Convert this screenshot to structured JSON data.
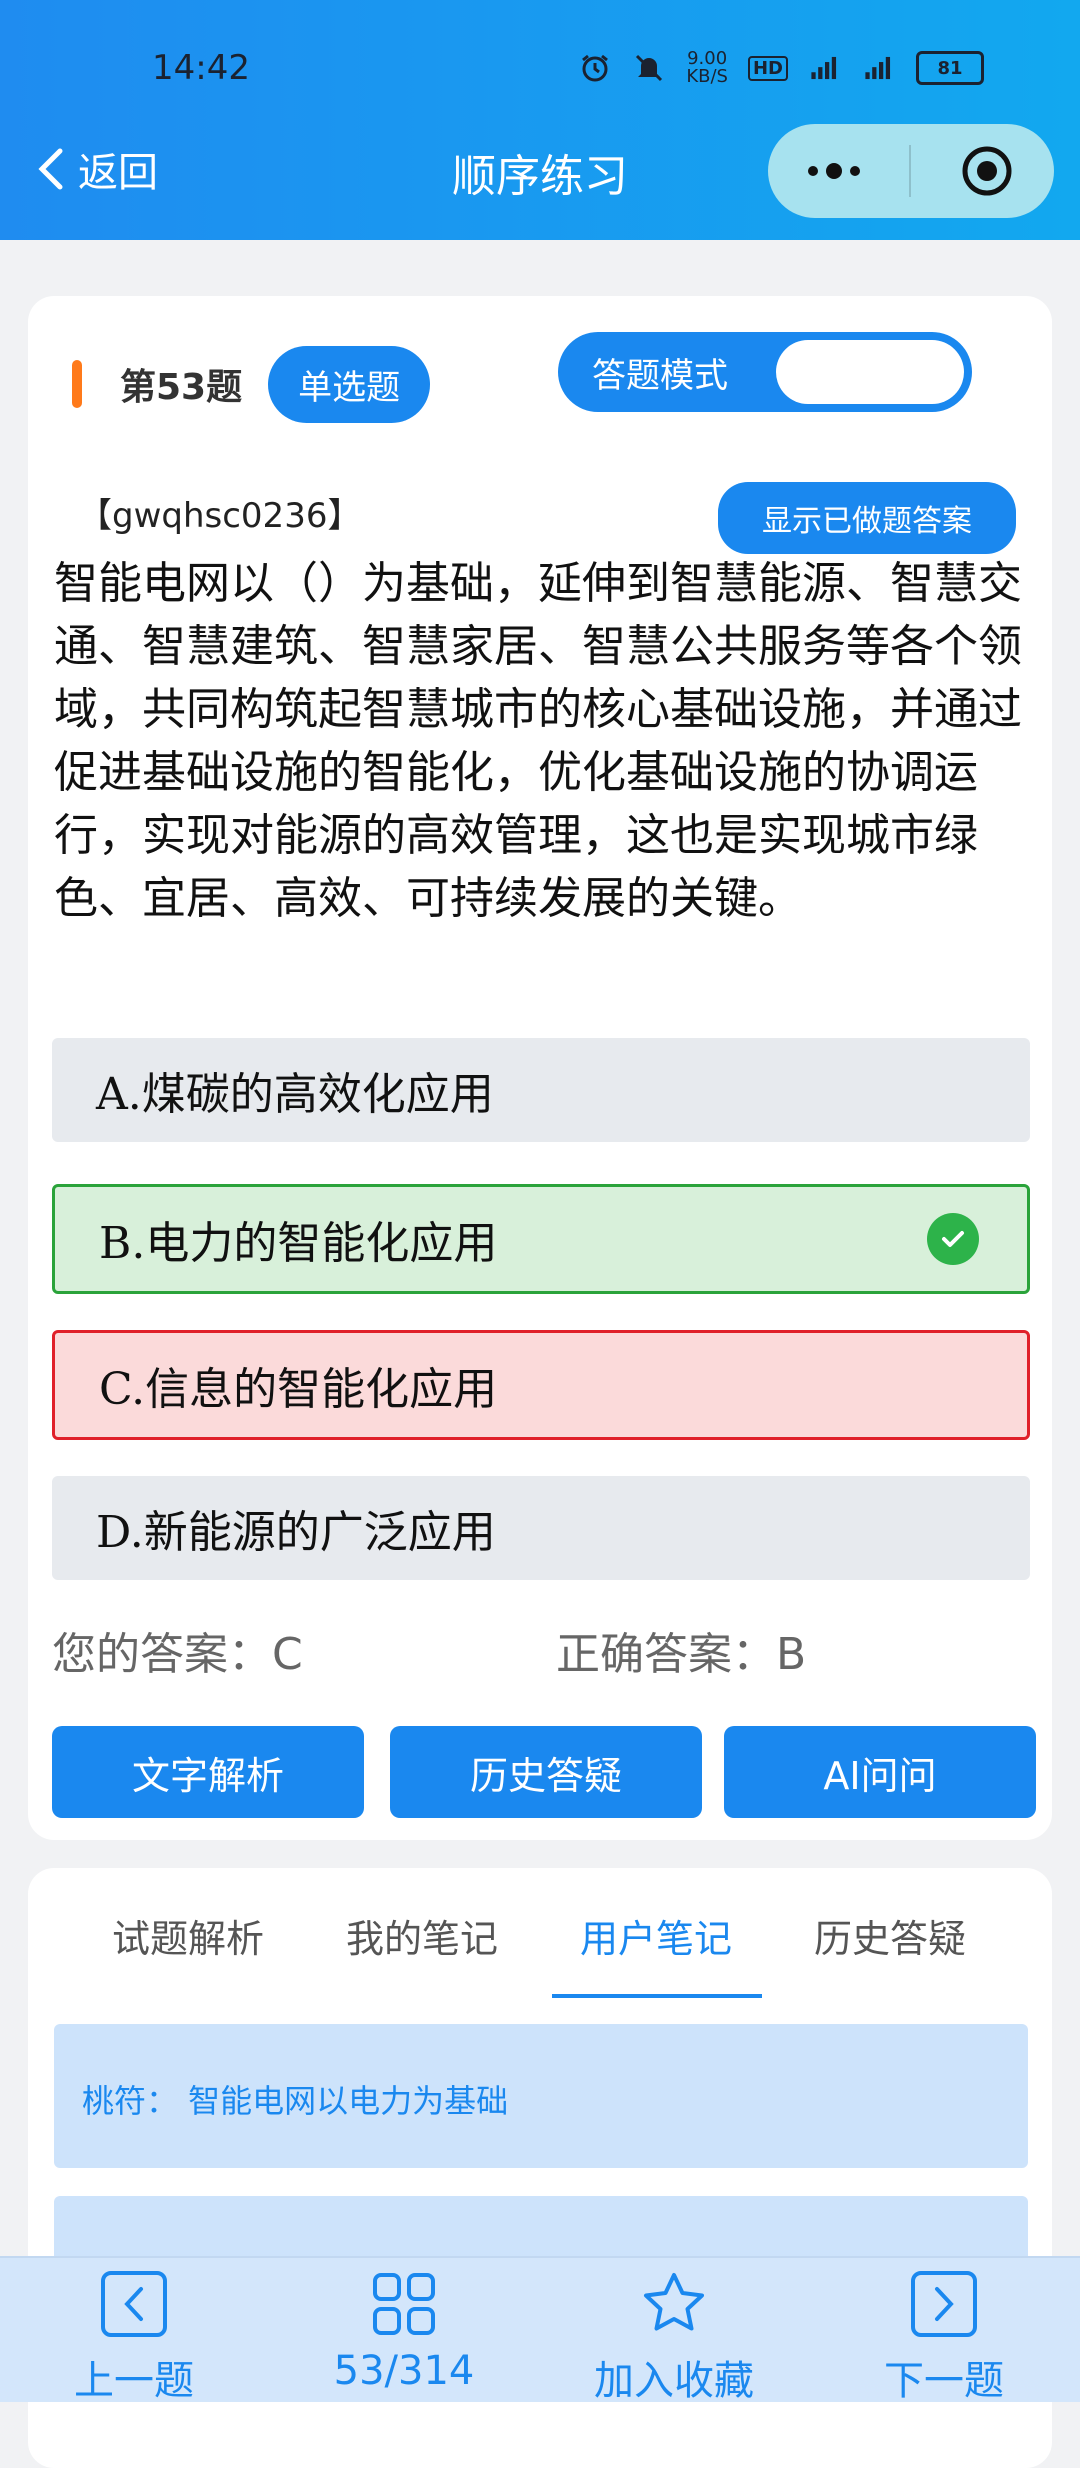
{
  "status_bar": {
    "time": "14:42",
    "net_speed": "9.00\nKB/S",
    "battery": "81"
  },
  "nav": {
    "back_label": "返回",
    "title": "顺序练习"
  },
  "question": {
    "number_label": "第53题",
    "type_label": "单选题",
    "mode_label": "答题模式",
    "code": "【gwqhsc0236】",
    "show_answer_label": "显示已做题答案",
    "text": "智能电网以（）为基础，延伸到智慧能源、智慧交通、智慧建筑、智慧家居、智慧公共服务等各个领域，共同构筑起智慧城市的核心基础设施，并通过促进基础设施的智能化，优化基础设施的协调运行，实现对能源的高效管理，这也是实现城市绿色、宜居、高效、可持续发展的关键。",
    "options": [
      {
        "label": "A.煤碳的高效化应用",
        "state": "neutral"
      },
      {
        "label": "B.电力的智能化应用",
        "state": "correct"
      },
      {
        "label": "C.信息的智能化应用",
        "state": "wrong"
      },
      {
        "label": "D.新能源的广泛应用",
        "state": "neutral"
      }
    ],
    "your_answer": "您的答案：C",
    "correct_answer": "正确答案：B",
    "buttons": {
      "analysis": "文字解析",
      "history": "历史答疑",
      "ai": "AI问问"
    }
  },
  "notes": {
    "tabs": [
      "试题解析",
      "我的笔记",
      "用户笔记",
      "历史答疑"
    ],
    "active_tab_index": 2,
    "items": [
      {
        "text": "桃符：  智能电网以电力为基础"
      }
    ]
  },
  "bottom_nav": {
    "prev": "上一题",
    "progress": "53/314",
    "favorite": "加入收藏",
    "next": "下一题"
  },
  "colors": {
    "accent": "#1a88ef",
    "correct": "#2aa33a",
    "wrong": "#e0202a",
    "orange": "#ff7a1a"
  }
}
